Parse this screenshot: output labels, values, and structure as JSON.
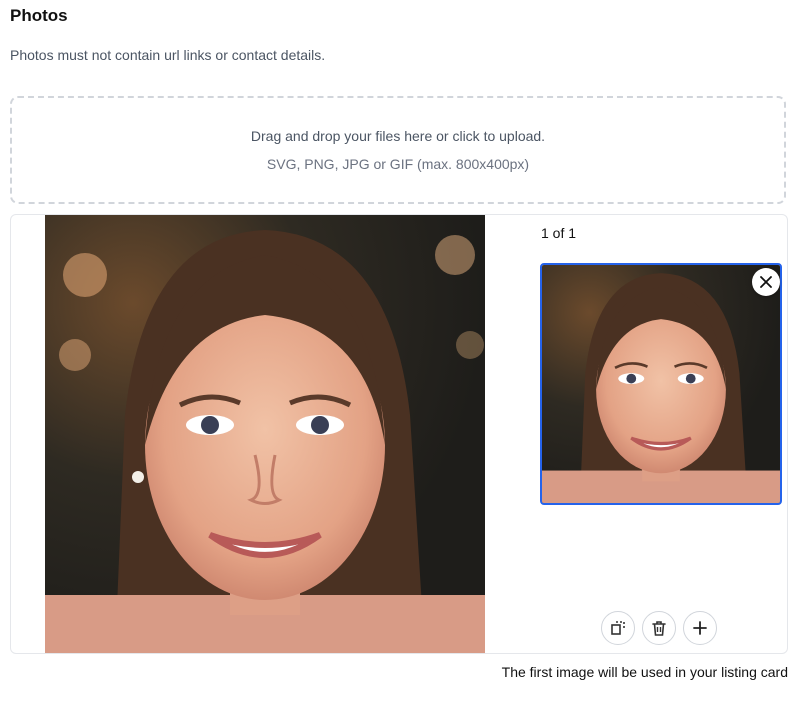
{
  "section": {
    "title": "Photos",
    "subtitle": "Photos must not contain url links or contact details."
  },
  "dropzone": {
    "main_text": "Drag and drop your files here or click to upload.",
    "hint_text": "SVG, PNG, JPG or GIF (max. 800x400px)"
  },
  "gallery": {
    "counter": "1 of 1",
    "selected_border_color": "#2563eb",
    "tools": [
      {
        "name": "crop",
        "icon": "crop-icon"
      },
      {
        "name": "delete",
        "icon": "trash-icon"
      },
      {
        "name": "add",
        "icon": "plus-icon"
      }
    ]
  },
  "footnote": "The first image will be used in your listing card"
}
